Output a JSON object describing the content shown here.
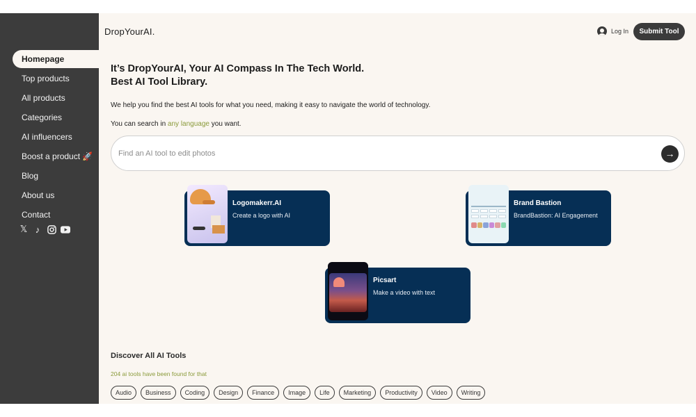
{
  "app": {
    "logo": "DropYourAI."
  },
  "sidebar": {
    "items": [
      {
        "label": "Homepage",
        "active": true
      },
      {
        "label": "Top products"
      },
      {
        "label": "All products"
      },
      {
        "label": "Categories"
      },
      {
        "label": "AI influencers"
      },
      {
        "label": "Boost a product 🚀"
      },
      {
        "label": "Blog"
      },
      {
        "label": "About us"
      },
      {
        "label": "Contact"
      }
    ],
    "socials": [
      "x-icon",
      "tiktok-icon",
      "instagram-icon",
      "youtube-icon"
    ]
  },
  "header": {
    "login_label": "Log In",
    "submit_label": "Submit Tool"
  },
  "hero": {
    "title_line1": "It’s DropYourAI, Your AI Compass In The Tech World.",
    "title_line2": "Best AI Tool Library.",
    "subtitle": "We help you find the best AI tools for what you need, making it easy to navigate the world of technology.",
    "lang_prefix": "You can search in ",
    "lang_accent": "any language",
    "lang_suffix": " you want."
  },
  "search": {
    "placeholder": "Find an AI tool to edit photos",
    "value": ""
  },
  "featured": [
    {
      "title": "Logomakerr.AI",
      "description": "Create a logo with AI"
    },
    {
      "title": "Brand Bastion",
      "description": "BrandBastion: AI Engagement"
    },
    {
      "title": "Picsart",
      "description": "Make a video with text"
    }
  ],
  "discover": {
    "title": "Discover All AI Tools",
    "count_text": "204 ai tools have been found for that",
    "categories": [
      "Audio",
      "Business",
      "Coding",
      "Design",
      "Finance",
      "Image",
      "Life",
      "Marketing",
      "Productivity",
      "Video",
      "Writing"
    ]
  },
  "colors": {
    "sidebar": "#3c3c3c",
    "background": "#faf6f1",
    "card": "#062f55",
    "accent": "#8a9a3a"
  }
}
